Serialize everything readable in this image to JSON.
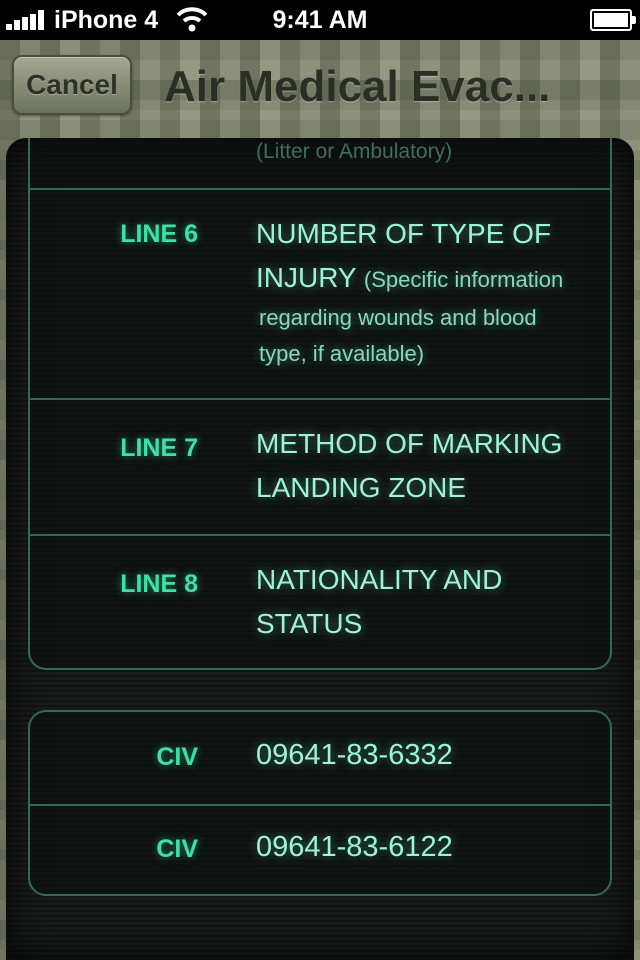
{
  "status_bar": {
    "carrier": "iPhone 4",
    "time": "9:41 AM"
  },
  "nav": {
    "cancel_label": "Cancel",
    "title": "Air Medical Evac..."
  },
  "lines": {
    "prev_subtext": "(Litter or Ambulatory)",
    "line6": {
      "label": "LINE 6",
      "title_part1": "NUMBER OF TYPE OF",
      "title_part2": "INJURY",
      "detail_inline": "(Specific information",
      "detail_rest_1": "regarding wounds and blood",
      "detail_rest_2": "type, if available)"
    },
    "line7": {
      "label": "LINE 7",
      "title_1": "METHOD OF MARKING",
      "title_2": "LANDING ZONE"
    },
    "line8": {
      "label": "LINE 8",
      "title_1": "NATIONALITY AND",
      "title_2": "STATUS"
    }
  },
  "contacts": [
    {
      "label": "CIV",
      "number": "09641-83-6332"
    },
    {
      "label": "CIV",
      "number": "09641-83-6122"
    }
  ],
  "colors": {
    "accent": "#3fe0a8",
    "text": "#9ff2d5",
    "border": "#2f6a55"
  }
}
